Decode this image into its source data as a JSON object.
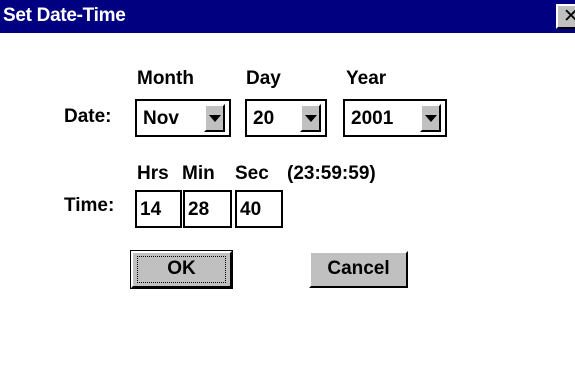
{
  "window": {
    "title": "Set Date-Time",
    "close_glyph": "✕"
  },
  "date": {
    "label": "Date:",
    "headers": {
      "month": "Month",
      "day": "Day",
      "year": "Year"
    },
    "month": "Nov",
    "day": "20",
    "year": "2001"
  },
  "time": {
    "label": "Time:",
    "headers": {
      "hrs": "Hrs",
      "min": "Min",
      "sec": "Sec",
      "format": "(23:59:59)"
    },
    "hrs": "14",
    "min": "28",
    "sec": "40"
  },
  "buttons": {
    "ok": "OK",
    "cancel": "Cancel"
  },
  "colors": {
    "titlebar": "#000080",
    "button_face": "#c0c0c0",
    "background": "#ffffff"
  },
  "icons": {
    "close": "close-icon",
    "dropdown": "chevron-down-icon"
  }
}
